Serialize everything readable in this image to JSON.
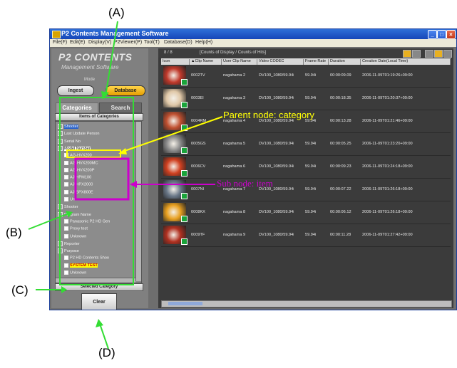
{
  "annotations": {
    "A": "(A)",
    "B": "(B)",
    "C": "(C)",
    "D": "(D)",
    "parent_node": "Parent node: category",
    "sub_node": "Sub node: item",
    "parent_color": "#ffff00",
    "sub_color": "#cc00cc",
    "arrow_color": "#33dd33"
  },
  "window": {
    "title": "P2 Contents Management Software",
    "menu": [
      "File(F)",
      "Edit(E)",
      "Display(V)",
      "P2Viewer(P)",
      "Tool(T)",
      "Database(D)",
      "Help(H)"
    ]
  },
  "left": {
    "logo": "P2 CONTENTS",
    "logo_sub": "Management Software",
    "mode_label": "Mode",
    "ingest": "Ingest",
    "database": "Database",
    "tab_categories": "Categories",
    "tab_search": "Search",
    "items_header": "Items of Categories",
    "selected_header": "Selected Category",
    "clear": "Clear",
    "tree": [
      {
        "label": "Shooter",
        "level": 0,
        "type": "sel"
      },
      {
        "label": "Last Update Person",
        "level": 0,
        "type": "box"
      },
      {
        "label": "Serial No",
        "level": 0,
        "type": "box"
      },
      {
        "label": "Model Number",
        "level": 0,
        "type": "parent"
      },
      {
        "label": "AG-HVX200",
        "level": 1,
        "type": "chk"
      },
      {
        "label": "AG-HVX200MC",
        "level": 1,
        "type": "chk"
      },
      {
        "label": "AG-HVX200P",
        "level": 1,
        "type": "chk"
      },
      {
        "label": "AJ-HPM100",
        "level": 1,
        "type": "chk"
      },
      {
        "label": "AJ-HPX2000",
        "level": 1,
        "type": "chk"
      },
      {
        "label": "AJ-SPX800E",
        "level": 1,
        "type": "chk"
      },
      {
        "label": "Unknown",
        "level": 1,
        "type": "chk"
      },
      {
        "label": "Shooter",
        "level": 0,
        "type": "box"
      },
      {
        "label": "Program Name",
        "level": 0,
        "type": "box"
      },
      {
        "label": "Panasonic P2 HD Gen",
        "level": 1,
        "type": "chk"
      },
      {
        "label": "Proxy test",
        "level": 1,
        "type": "chk"
      },
      {
        "label": "Unknown",
        "level": 1,
        "type": "chk"
      },
      {
        "label": "Reporter",
        "level": 0,
        "type": "box"
      },
      {
        "label": "Purpose",
        "level": 0,
        "type": "box"
      },
      {
        "label": "P2 HD Contents Shoo",
        "level": 1,
        "type": "chk"
      },
      {
        "label": "SYSTEM TEST",
        "level": 1,
        "type": "hl"
      },
      {
        "label": "Unknown",
        "level": 1,
        "type": "chk"
      }
    ]
  },
  "grid": {
    "count": "8 / 8",
    "count_label": "[Counts of Display / Counts of Hits]",
    "columns": [
      "Icon",
      "▲Clip Name",
      "User Clip Name",
      "Video CODEC",
      "Frame Rate",
      "Duration",
      "Creation Date(Local Time)"
    ],
    "rows": [
      {
        "clip": "0002TV",
        "user": "nagahama 2",
        "codec": "DV100_1080/59.94i",
        "rate": "59.94i",
        "duration": "00:00:09.09",
        "created": "2006-11-09T01:19:26+09:00",
        "thumb": "#c0392b"
      },
      {
        "clip": "0003EI",
        "user": "nagahama 3",
        "codec": "DV100_1080/59.94i",
        "rate": "59.94i",
        "duration": "00:00:18.35",
        "created": "2006-11-09T01:20:37+09:00",
        "thumb": "#e0c8a8"
      },
      {
        "clip": "0004RM",
        "user": "nagahama 4",
        "codec": "DV100_1080/59.94i",
        "rate": "59.94i",
        "duration": "00:00:13.28",
        "created": "2006-11-09T01:21:46+09:00",
        "thumb": "#c05030"
      },
      {
        "clip": "0005GS",
        "user": "nagahama 5",
        "codec": "DV100_1080/59.94i",
        "rate": "59.94i",
        "duration": "00:00:05.25",
        "created": "2006-11-09T01:23:20+09:00",
        "thumb": "#8a8a8a"
      },
      {
        "clip": "0006CV",
        "user": "nagahama 6",
        "codec": "DV100_1080/59.94i",
        "rate": "59.94i",
        "duration": "00:00:09.23",
        "created": "2006-11-09T01:24:18+09:00",
        "thumb": "#d04020"
      },
      {
        "clip": "0007NI",
        "user": "nagahama 7",
        "codec": "DV100_1080/59.94i",
        "rate": "59.94i",
        "duration": "00:00:07.22",
        "created": "2006-11-09T01:26:18+09:00",
        "thumb": "#6a7888"
      },
      {
        "clip": "0008KX",
        "user": "nagahama 8",
        "codec": "DV100_1080/59.94i",
        "rate": "59.94i",
        "duration": "00:00:06.12",
        "created": "2006-11-09T01:26:18+09:00",
        "thumb": "#e8a020"
      },
      {
        "clip": "0009TF",
        "user": "nagahama 9",
        "codec": "DV100_1080/59.94i",
        "rate": "59.94i",
        "duration": "00:00:11.28",
        "created": "2006-11-09T01:27:42+09:00",
        "thumb": "#b03020"
      }
    ]
  }
}
